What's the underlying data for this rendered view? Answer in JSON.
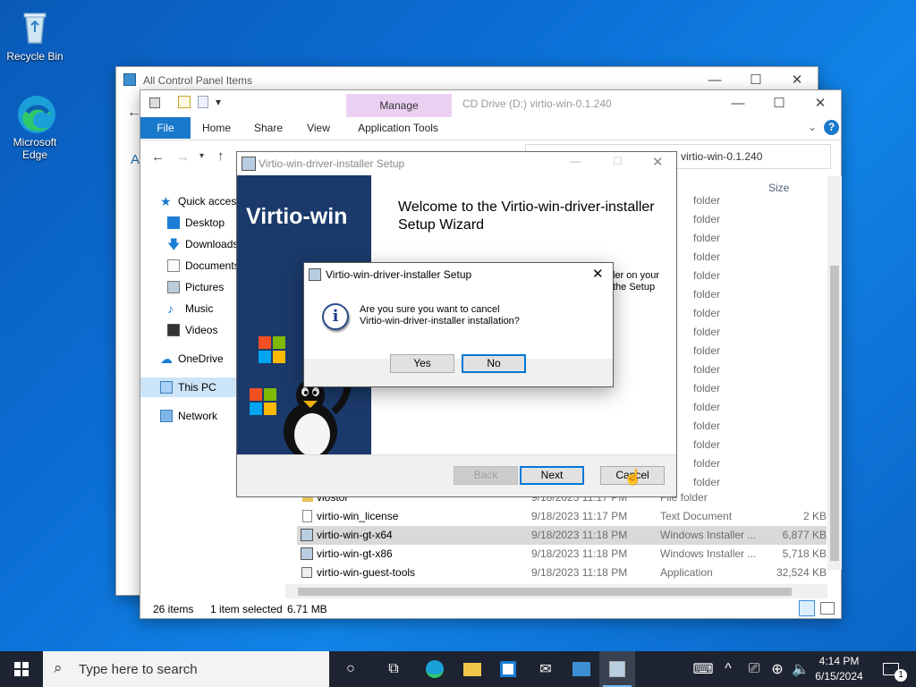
{
  "desktop": {
    "icons": [
      {
        "label": "Recycle Bin"
      },
      {
        "label": "Microsoft Edge"
      }
    ]
  },
  "control_panel": {
    "title": "All Control Panel Items"
  },
  "explorer": {
    "title": "CD Drive (D:) virtio-win-0.1.240",
    "ribbon": {
      "manage_label": "Manage",
      "tabs": [
        "File",
        "Home",
        "Share",
        "View",
        "Application Tools"
      ]
    },
    "address": "virtio-win-0.1.240",
    "column_size": "Size",
    "nav": [
      {
        "label": "Quick access"
      },
      {
        "label": "Desktop"
      },
      {
        "label": "Downloads"
      },
      {
        "label": "Documents"
      },
      {
        "label": "Pictures"
      },
      {
        "label": "Music"
      },
      {
        "label": "Videos"
      },
      {
        "label": "OneDrive"
      },
      {
        "label": "This PC"
      },
      {
        "label": "Network"
      }
    ],
    "folder_type_rows": [
      "folder",
      "folder",
      "folder",
      "folder",
      "folder",
      "folder",
      "folder",
      "folder",
      "folder",
      "folder",
      "folder",
      "folder",
      "folder",
      "folder",
      "folder",
      "folder"
    ],
    "files": [
      {
        "name": "viostor",
        "date": "9/18/2023 11:17 PM",
        "type": "File folder",
        "size": ""
      },
      {
        "name": "virtio-win_license",
        "date": "9/18/2023 11:17 PM",
        "type": "Text Document",
        "size": "2 KB"
      },
      {
        "name": "virtio-win-gt-x64",
        "date": "9/18/2023 11:18 PM",
        "type": "Windows Installer ...",
        "size": "6,877 KB"
      },
      {
        "name": "virtio-win-gt-x86",
        "date": "9/18/2023 11:18 PM",
        "type": "Windows Installer ...",
        "size": "5,718 KB"
      },
      {
        "name": "virtio-win-guest-tools",
        "date": "9/18/2023 11:18 PM",
        "type": "Application",
        "size": "32,524 KB"
      }
    ],
    "status": {
      "items": "26 items",
      "selected": "1 item selected",
      "size": "6.71 MB"
    }
  },
  "setup": {
    "title": "Virtio-win-driver-installer Setup",
    "brand": "Virtio-win",
    "welcome": "Welcome to the Virtio-win-driver-installer Setup Wizard",
    "body_fragment_1": "ler on your",
    "body_fragment_2": "the Setup",
    "buttons": {
      "back": "Back",
      "next": "Next",
      "cancel": "Cancel"
    }
  },
  "dialog": {
    "title": "Virtio-win-driver-installer Setup",
    "message_line1": "Are you sure you want to cancel",
    "message_line2": "Virtio-win-driver-installer installation?",
    "yes": "Yes",
    "no": "No"
  },
  "taskbar": {
    "search_placeholder": "Type here to search",
    "time": "4:14 PM",
    "date": "6/15/2024",
    "notification_count": "1"
  },
  "colors": {
    "accent": "#0078d7",
    "setup_banner": "#1b3a6b",
    "manage_tab": "#e8c8f0",
    "taskbar": "#1d2330"
  }
}
